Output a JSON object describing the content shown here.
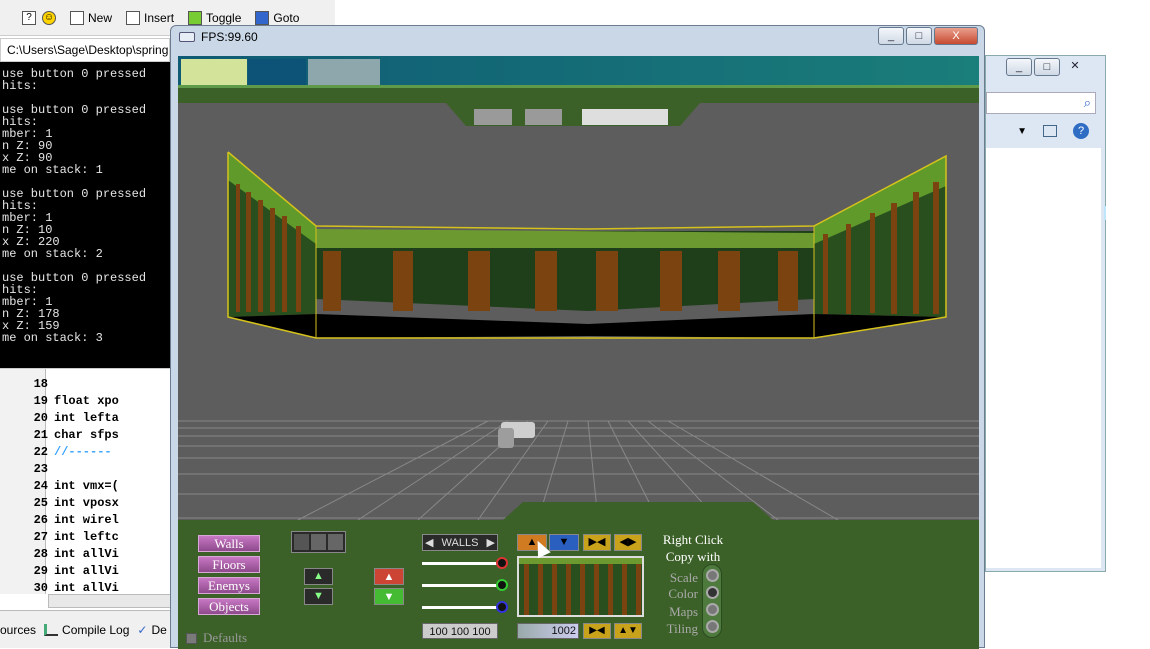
{
  "ide_toolbar": {
    "items": [
      {
        "icon": "help-icon",
        "label": ""
      },
      {
        "icon": "smiley-icon",
        "label": ""
      },
      {
        "icon": "new-file-icon",
        "label": "New"
      },
      {
        "icon": "insert-icon",
        "label": "Insert"
      },
      {
        "icon": "toggle-icon",
        "label": "Toggle"
      },
      {
        "icon": "goto-icon",
        "label": "Goto"
      }
    ]
  },
  "console": {
    "path": "C:\\Users\\Sage\\Desktop\\spring",
    "lines": [
      "use button 0 pressed",
      "hits:",
      "",
      "use button 0 pressed",
      "hits:",
      "mber: 1",
      "n Z: 90",
      "x Z: 90",
      "me on stack: 1",
      "",
      "use button 0 pressed",
      "hits:",
      "mber: 1",
      "n Z: 10",
      "x Z: 220",
      "me on stack: 2",
      "",
      "use button 0 pressed",
      "hits:",
      "mber: 1",
      "n Z: 178",
      "x Z: 159",
      "me on stack: 3"
    ]
  },
  "code": {
    "lines": [
      {
        "n": "18",
        "text": ""
      },
      {
        "n": "19",
        "text": "float xpo"
      },
      {
        "n": "20",
        "text": "int lefta"
      },
      {
        "n": "21",
        "text": "char sfps"
      },
      {
        "n": "22",
        "text": "//------"
      },
      {
        "n": "23",
        "text": ""
      },
      {
        "n": "24",
        "text": "int vmx=("
      },
      {
        "n": "25",
        "text": "int vposx"
      },
      {
        "n": "26",
        "text": "int wirel"
      },
      {
        "n": "27",
        "text": "int leftc"
      },
      {
        "n": "28",
        "text": "int allVi"
      },
      {
        "n": "29",
        "text": "int allVi"
      },
      {
        "n": "30",
        "text": "int allVi"
      }
    ]
  },
  "bottom_tabs": [
    "ources",
    "Compile Log",
    "De"
  ],
  "game": {
    "title": "FPS:99.60",
    "controls": [
      "_",
      "□",
      "X"
    ]
  },
  "panel": {
    "menu": [
      "Walls",
      "Floors",
      "Enemys",
      "Objects"
    ],
    "defaults_label": "Defaults",
    "walls_selector": "WALLS",
    "rgb_values": "100 100 100",
    "texture_value": "1002",
    "right_click_title_1": "Right Click",
    "right_click_title_2": "Copy with",
    "options": [
      "Scale",
      "Color",
      "Maps",
      "Tiling"
    ],
    "colors": {
      "panel": "#3c6128",
      "menu_button": "#b064ac",
      "wall_green": "#3f7d1d",
      "wall_brown": "#7a4310",
      "floor": "#5d5d5d"
    }
  }
}
